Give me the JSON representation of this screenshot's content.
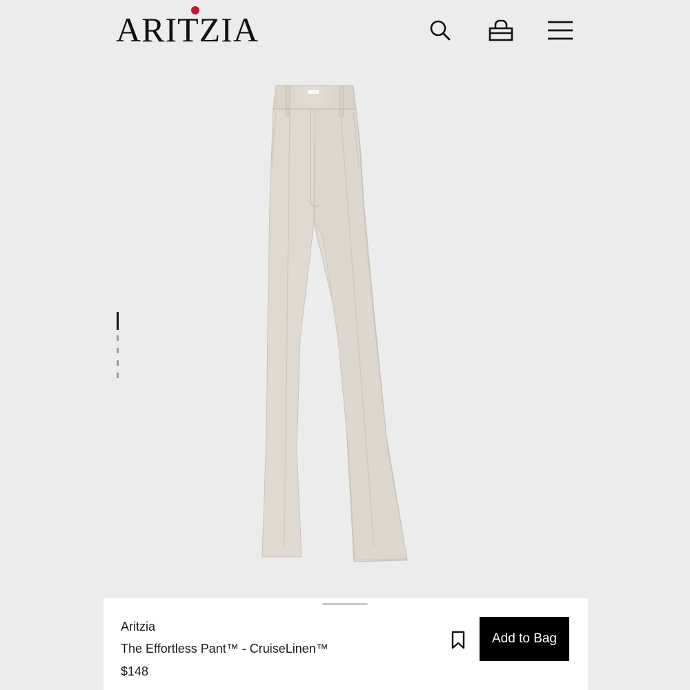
{
  "header": {
    "logo_text": "ARITZIA",
    "search_icon": "search-icon",
    "bag_icon": "shopping-bag-icon",
    "menu_icon": "hamburger-menu-icon"
  },
  "carousel": {
    "total_images": 5,
    "active_index": 0
  },
  "product": {
    "brand": "Aritzia",
    "name": "The Effortless Pant™ - CruiseLinen™",
    "price": "$148",
    "add_to_bag_label": "Add to Bag",
    "wishlist_icon": "bookmark-icon"
  },
  "colors": {
    "background": "#ececec",
    "sheet": "#ffffff",
    "button": "#000000",
    "logo_accent": "#c4122f",
    "pant_fabric": "#dcd6cc"
  }
}
